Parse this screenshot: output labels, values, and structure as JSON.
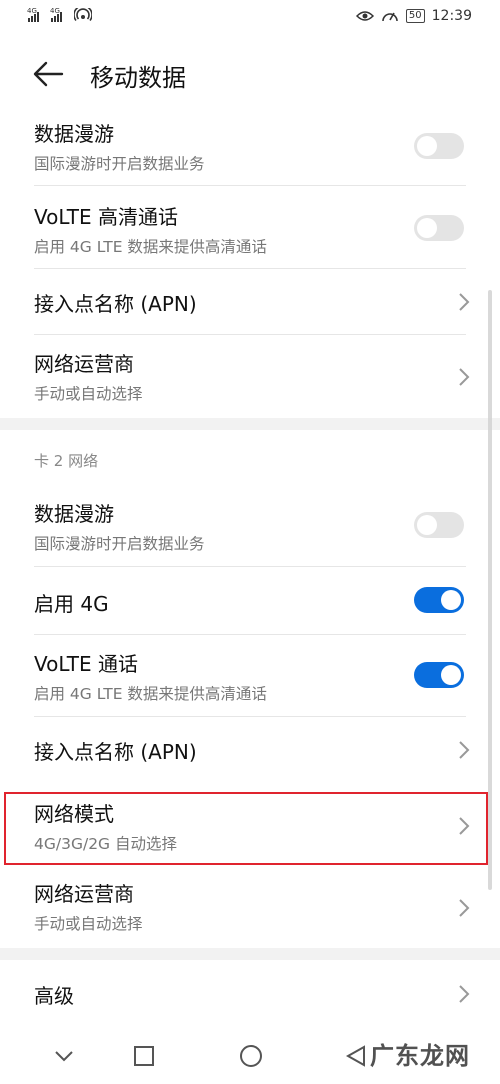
{
  "status": {
    "sim1_label": "4G",
    "sim2_label": "4G",
    "battery": "50",
    "time": "12:39"
  },
  "header": {
    "title": "移动数据"
  },
  "sim1": {
    "data_roaming": {
      "title": "数据漫游",
      "subtitle": "国际漫游时开启数据业务",
      "enabled": false
    },
    "volte": {
      "title": "VoLTE 高清通话",
      "subtitle": "启用 4G LTE 数据来提供高清通话",
      "enabled": false
    },
    "apn": {
      "title": "接入点名称 (APN)"
    },
    "carrier": {
      "title": "网络运营商",
      "subtitle": "手动或自动选择"
    }
  },
  "sim2": {
    "section_title": "卡 2 网络",
    "data_roaming": {
      "title": "数据漫游",
      "subtitle": "国际漫游时开启数据业务",
      "enabled": false
    },
    "enable_4g": {
      "title": "启用 4G",
      "enabled": true
    },
    "volte": {
      "title": "VoLTE 通话",
      "subtitle": "启用 4G LTE 数据来提供高清通话",
      "enabled": true
    },
    "apn": {
      "title": "接入点名称 (APN)"
    },
    "network_mode": {
      "title": "网络模式",
      "subtitle": "4G/3G/2G 自动选择"
    },
    "carrier": {
      "title": "网络运营商",
      "subtitle": "手动或自动选择"
    }
  },
  "advanced": {
    "title": "高级"
  },
  "watermark": "广东龙网",
  "colors": {
    "accent": "#0a6ede",
    "highlight": "#e0242e"
  }
}
